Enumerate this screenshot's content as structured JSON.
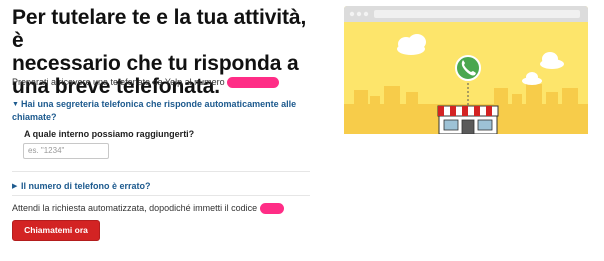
{
  "headline": "Per tutelare te e la tua attività, è\nnecessario che tu risponda a\nuna breve telefonata.",
  "intro_text": "Preparati a ricevere una telefonata da Yelp al numero",
  "voicemail_toggle": "Hai una segreteria telefonica che risponde automaticamente alle chiamate?",
  "extension_label": "A quale interno possiamo raggiungerti?",
  "extension_placeholder": "es. \"1234\"",
  "wrong_number_toggle": "Il numero di telefono è errato?",
  "instruction_text": "Attendi la richiesta automatizzata, dopodiché immetti il codice",
  "call_button": "Chiamatemi ora",
  "colors": {
    "link": "#1d5a8e",
    "button": "#d32323",
    "illustration_bg": "#fde56b",
    "redaction": "#ff2d86"
  },
  "icons": {
    "voicemail_toggle": "caret-down-icon",
    "wrong_number_toggle": "caret-right-icon",
    "phone": "phone-icon"
  }
}
